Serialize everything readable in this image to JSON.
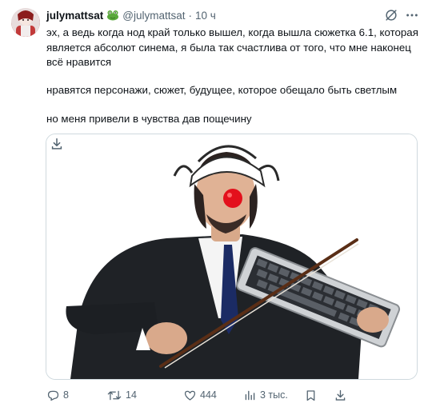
{
  "tweet": {
    "username": "julymattsat",
    "handle": "@julymattsat",
    "separator": "·",
    "time": "10 ч",
    "paragraph1": "эх, а ведь когда нод край только вышел, когда вышла сюжетка 6.1, которая является абсолют синема, я была так счастлива от того, что мне наконец всё нравится",
    "paragraph2": "нравятся персонажи, сюжет, будущее, которое обещало быть светлым",
    "paragraph3": "но меня привели в чувства дав пощечину"
  },
  "icons": {
    "verified_emoji": "frog-emoji",
    "grok": "grok-icon",
    "more": "more-icon",
    "download": "download-icon"
  },
  "actions": {
    "replies": "8",
    "reposts": "14",
    "likes": "444",
    "views": "3 тыс."
  },
  "colors": {
    "text": "#0f1419",
    "secondary": "#536471",
    "border": "#cfd9de",
    "emoji_green": "#59a83a"
  }
}
